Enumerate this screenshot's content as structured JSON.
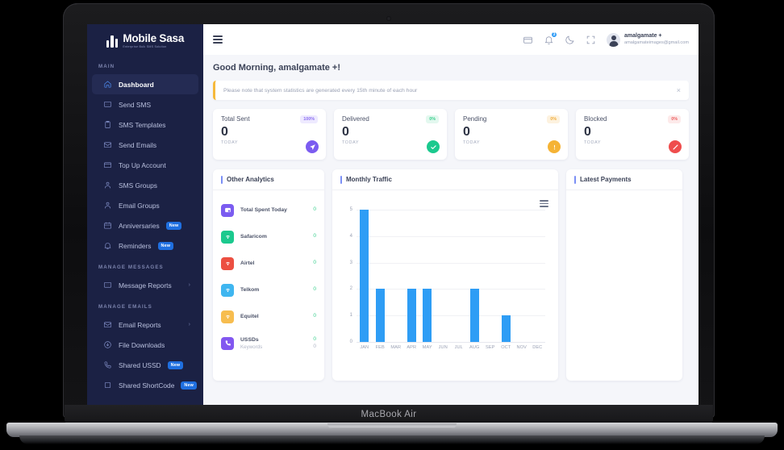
{
  "device": {
    "label": "MacBook Air"
  },
  "sidebar": {
    "brand": {
      "name": "Mobile Sasa",
      "tagline": "Enterprise Bulk SMS Solution"
    },
    "sections": [
      {
        "label": "MAIN",
        "items": [
          {
            "label": "Dashboard",
            "icon": "home-icon",
            "active": true,
            "badge": "",
            "chevron": false
          },
          {
            "label": "Send SMS",
            "icon": "chat-icon",
            "active": false,
            "badge": "",
            "chevron": false
          },
          {
            "label": "SMS Templates",
            "icon": "clipboard-icon",
            "active": false,
            "badge": "",
            "chevron": false
          },
          {
            "label": "Send Emails",
            "icon": "envelope-icon",
            "active": false,
            "badge": "",
            "chevron": false
          },
          {
            "label": "Top Up Account",
            "icon": "wallet-icon",
            "active": false,
            "badge": "",
            "chevron": false
          },
          {
            "label": "SMS Groups",
            "icon": "users-icon",
            "active": false,
            "badge": "",
            "chevron": false
          },
          {
            "label": "Email Groups",
            "icon": "users-icon",
            "active": false,
            "badge": "",
            "chevron": false
          },
          {
            "label": "Anniversaries",
            "icon": "calendar-icon",
            "active": false,
            "badge": "New",
            "chevron": false
          },
          {
            "label": "Reminders",
            "icon": "bell-icon",
            "active": false,
            "badge": "New",
            "chevron": false
          }
        ]
      },
      {
        "label": "MANAGE MESSAGES",
        "items": [
          {
            "label": "Message Reports",
            "icon": "chat-icon",
            "active": false,
            "badge": "",
            "chevron": true
          }
        ]
      },
      {
        "label": "MANAGE EMAILS",
        "items": [
          {
            "label": "Email Reports",
            "icon": "envelope-icon",
            "active": false,
            "badge": "",
            "chevron": true
          },
          {
            "label": "File Downloads",
            "icon": "download-circle-icon",
            "active": false,
            "badge": "",
            "chevron": false
          },
          {
            "label": "Shared USSD",
            "icon": "phone-icon",
            "active": false,
            "badge": "New",
            "chevron": false
          },
          {
            "label": "Shared ShortCode",
            "icon": "square-icon",
            "active": false,
            "badge": "New",
            "chevron": false
          }
        ]
      }
    ]
  },
  "topbar": {
    "menu_icon": "hamburger-icon",
    "icons": [
      {
        "name": "wallet-icon",
        "badge": ""
      },
      {
        "name": "bell-icon",
        "badge": "3"
      },
      {
        "name": "moon-icon",
        "badge": ""
      },
      {
        "name": "fullscreen-icon",
        "badge": ""
      }
    ],
    "user": {
      "name": "amalgamate +",
      "email": "amalgamateimages@gmail.com",
      "avatar": "user-avatar-icon"
    }
  },
  "main": {
    "greeting": "Good Morning, amalgamate +!",
    "alert": {
      "text": "Please note that system statistics are generated every 15th minute of each hour",
      "close_label": "×",
      "accent_color": "#f6b93b"
    },
    "stat_cards": [
      {
        "title": "Total Sent",
        "percent": "100%",
        "value": "0",
        "sub": "TODAY",
        "pct_class": "purple",
        "icon": "send-icon",
        "icon_class": "ic-purple",
        "color": "#7b5cf0"
      },
      {
        "title": "Delivered",
        "percent": "0%",
        "value": "0",
        "sub": "TODAY",
        "pct_class": "green",
        "icon": "check-icon",
        "icon_class": "ic-green",
        "color": "#1bc98e"
      },
      {
        "title": "Pending",
        "percent": "0%",
        "value": "0",
        "sub": "TODAY",
        "pct_class": "orange",
        "icon": "exclamation-icon",
        "icon_class": "ic-orange",
        "color": "#f5b335"
      },
      {
        "title": "Blocked",
        "percent": "0%",
        "value": "0",
        "sub": "TODAY",
        "pct_class": "red",
        "icon": "block-icon",
        "icon_class": "ic-red",
        "color": "#ef4d4d"
      }
    ],
    "other_analytics": {
      "title": "Other Analytics",
      "rows": [
        {
          "label": "Total Spent Today",
          "sublabel": "",
          "value": "0",
          "subvalue": "",
          "icon": "spend-icon",
          "color_class": "bg-purple"
        },
        {
          "label": "Safaricom",
          "sublabel": "",
          "value": "0",
          "subvalue": "",
          "icon": "signal-icon",
          "color_class": "bg-green"
        },
        {
          "label": "Airtel",
          "sublabel": "",
          "value": "0",
          "subvalue": "",
          "icon": "signal-icon",
          "color_class": "bg-red"
        },
        {
          "label": "Telkom",
          "sublabel": "",
          "value": "0",
          "subvalue": "",
          "icon": "signal-icon",
          "color_class": "bg-blue"
        },
        {
          "label": "Equitel",
          "sublabel": "",
          "value": "0",
          "subvalue": "",
          "icon": "signal-icon",
          "color_class": "bg-amber"
        },
        {
          "label": "USSDs",
          "sublabel": "Keywords",
          "value": "0",
          "subvalue": "0",
          "icon": "phone-icon",
          "color_class": "bg-vio"
        }
      ]
    },
    "monthly_traffic": {
      "title": "Monthly Traffic",
      "menu_icon": "chart-menu-icon"
    },
    "latest_payments": {
      "title": "Latest Payments",
      "rows": []
    }
  },
  "chart_data": {
    "type": "bar",
    "title": "Monthly Traffic",
    "categories": [
      "JAN",
      "FEB",
      "MAR",
      "APR",
      "MAY",
      "JUN",
      "JUL",
      "AUG",
      "SEP",
      "OCT",
      "NOV",
      "DEC"
    ],
    "values": [
      5,
      2,
      0,
      2,
      2,
      0,
      0,
      2,
      0,
      1,
      0,
      0
    ],
    "yticks": [
      0,
      1,
      2,
      3,
      4,
      5
    ],
    "ylim": [
      0,
      5
    ],
    "xlabel": "",
    "ylabel": "",
    "grid": true,
    "legend": false,
    "bar_color": "#2e9df5"
  }
}
